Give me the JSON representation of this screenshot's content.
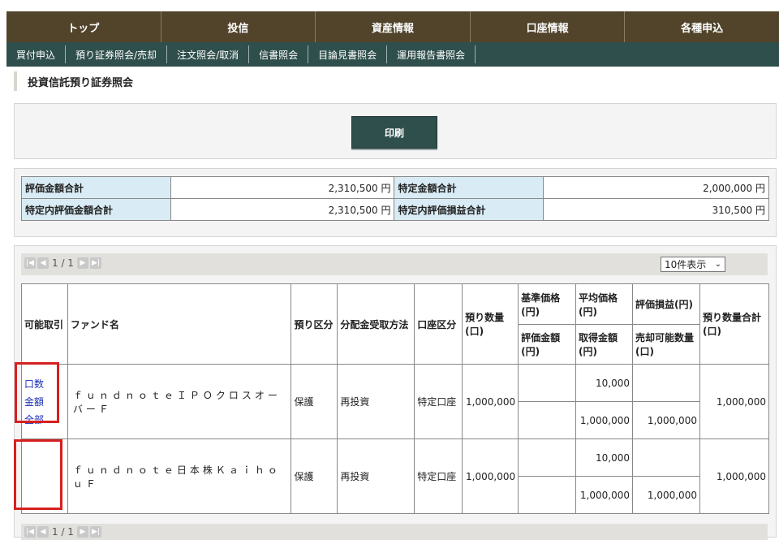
{
  "nav": {
    "top": [
      "トップ",
      "投信",
      "資産情報",
      "口座情報",
      "各種申込"
    ],
    "sub": [
      "買付申込",
      "預り証券照会/売却",
      "注文照会/取消",
      "信書照会",
      "目論見書照会",
      "運用報告書照会"
    ]
  },
  "page_title": "投資信託預り証券照会",
  "print_button": "印刷",
  "summary": {
    "eval_total_label": "評価金額合計",
    "eval_total_value": "2,310,500 円",
    "specific_total_label": "特定金額合計",
    "specific_total_value": "2,000,000 円",
    "specific_eval_label": "特定内評価金額合計",
    "specific_eval_value": "2,310,500 円",
    "specific_pl_label": "特定内評価損益合計",
    "specific_pl_value": "310,500 円"
  },
  "pager": {
    "page": "1 / 1",
    "per_page": "10件表示"
  },
  "table": {
    "headers": {
      "tradable": "可能取引",
      "fund": "ファンド名",
      "custody": "預り区分",
      "dividend": "分配金受取方法",
      "account": "口座区分",
      "qty": "預り数量(口)",
      "base_price": "基準価格(円)",
      "eval_amount": "評価金額(円)",
      "avg_price": "平均価格(円)",
      "acq_amount": "取得金額(円)",
      "eval_pl": "評価損益(円)",
      "sellable_qty": "売却可能数量(口)",
      "qty_total": "預り数量合計(口)"
    },
    "rows": [
      {
        "links": [
          "口数",
          "金額",
          "全部"
        ],
        "fund": "ｆｕｎｄｎｏｔｅＩＰＯクロスオーバーＦ",
        "custody": "保護",
        "dividend": "再投資",
        "account": "特定口座",
        "qty": "1,000,000",
        "base_price": "",
        "eval_amount": "",
        "avg_price": "10,000",
        "acq_amount": "1,000,000",
        "eval_pl": "",
        "sellable_qty": "1,000,000",
        "qty_total": "1,000,000"
      },
      {
        "links": [],
        "fund": "ｆｕｎｄｎｏｔｅ日本株ＫａｉｈｏｕＦ",
        "custody": "保護",
        "dividend": "再投資",
        "account": "特定口座",
        "qty": "1,000,000",
        "base_price": "",
        "eval_amount": "",
        "avg_price": "10,000",
        "acq_amount": "1,000,000",
        "eval_pl": "",
        "sellable_qty": "1,000,000",
        "qty_total": "1,000,000"
      }
    ]
  },
  "colors": {
    "nav_top": "#51442b",
    "nav_sub": "#2f4f4c",
    "label_bg": "#d9ecf5",
    "highlight": "#d62020",
    "link": "#1b2fb5"
  }
}
